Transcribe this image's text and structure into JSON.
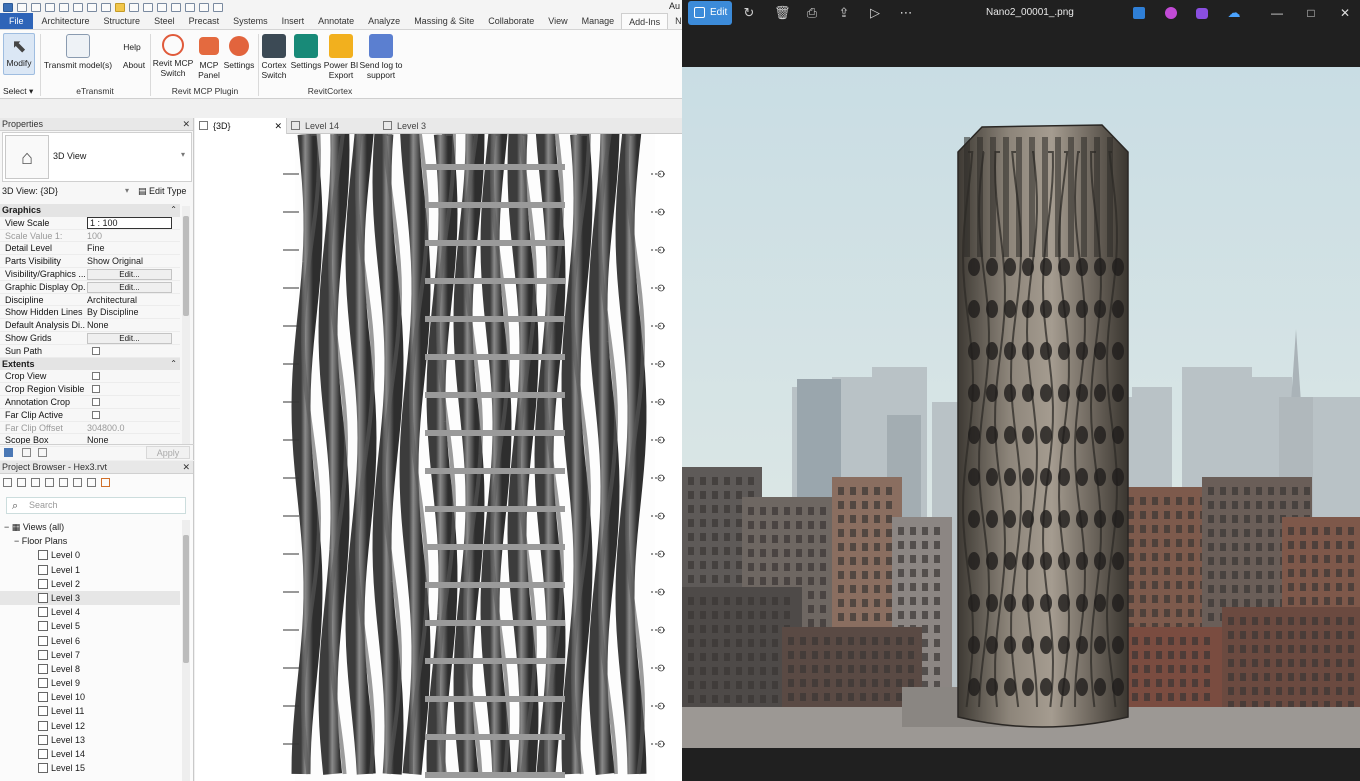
{
  "revit": {
    "title_fragment": "Au",
    "tabs": [
      "File",
      "Architecture",
      "Structure",
      "Steel",
      "Precast",
      "Systems",
      "Insert",
      "Annotate",
      "Analyze",
      "Massing & Site",
      "Collaborate",
      "View",
      "Manage",
      "Add-Ins",
      "NonicaTab"
    ],
    "active_tab": "Add-Ins",
    "ribbon": {
      "modify": "Modify",
      "select": "Select",
      "transmit": "Transmit model(s)",
      "help": "Help",
      "about": "About",
      "mcp_switch": "Revit MCP Switch",
      "mcp_panel": "MCP Panel",
      "mcp_settings": "Settings",
      "cortex_switch": "Cortex Switch",
      "cortex_settings": "Settings",
      "powerbi": "Power BI Export",
      "sendlog": "Send log to support",
      "groups": {
        "etransmit": "eTransmit",
        "mcp": "Revit MCP Plugin",
        "cortex": "RevitCortex"
      }
    },
    "properties": {
      "title": "Properties",
      "type_name": "3D View",
      "selector": "3D View: {3D}",
      "edit_type": "Edit Type",
      "apply": "Apply",
      "graphics_header": "Graphics",
      "extents_header": "Extents",
      "rows_graphics": [
        {
          "k": "View Scale",
          "v": "1 : 100",
          "t": "input"
        },
        {
          "k": "Scale Value    1:",
          "v": "100",
          "t": "dim"
        },
        {
          "k": "Detail Level",
          "v": "Fine",
          "t": "text"
        },
        {
          "k": "Parts Visibility",
          "v": "Show Original",
          "t": "text"
        },
        {
          "k": "Visibility/Graphics ...",
          "v": "Edit...",
          "t": "button"
        },
        {
          "k": "Graphic Display Op...",
          "v": "Edit...",
          "t": "button"
        },
        {
          "k": "Discipline",
          "v": "Architectural",
          "t": "text"
        },
        {
          "k": "Show Hidden Lines",
          "v": "By Discipline",
          "t": "text"
        },
        {
          "k": "Default Analysis Di...",
          "v": "None",
          "t": "text"
        },
        {
          "k": "Show Grids",
          "v": "Edit...",
          "t": "button"
        },
        {
          "k": "Sun Path",
          "v": "",
          "t": "check"
        }
      ],
      "rows_extents": [
        {
          "k": "Crop View",
          "v": "",
          "t": "check"
        },
        {
          "k": "Crop Region Visible",
          "v": "",
          "t": "check"
        },
        {
          "k": "Annotation Crop",
          "v": "",
          "t": "check"
        },
        {
          "k": "Far Clip Active",
          "v": "",
          "t": "check"
        },
        {
          "k": "Far Clip Offset",
          "v": "304800.0",
          "t": "dim"
        },
        {
          "k": "Scope Box",
          "v": "None",
          "t": "text"
        }
      ]
    },
    "browser": {
      "title": "Project Browser - Hex3.rvt",
      "search_placeholder": "Search",
      "views_root": "Views (all)",
      "floor_plans": "Floor Plans",
      "levels": [
        "Level 0",
        "Level 1",
        "Level 2",
        "Level 3",
        "Level 4",
        "Level 5",
        "Level 6",
        "Level 7",
        "Level 8",
        "Level 9",
        "Level 10",
        "Level 11",
        "Level 12",
        "Level 13",
        "Level 14",
        "Level 15"
      ],
      "selected_level": "Level 3"
    },
    "view_tabs": [
      {
        "label": "{3D}",
        "active": true
      },
      {
        "label": "Level 14",
        "active": false
      },
      {
        "label": "Level 3",
        "active": false
      }
    ]
  },
  "photos": {
    "edit": "Edit",
    "filename": "Nano2_00001_.png",
    "icons": [
      "rotate-icon",
      "delete-icon",
      "print-icon",
      "share-icon",
      "slideshow-icon",
      "more-icon"
    ],
    "window_controls": [
      "—",
      "□",
      "✕"
    ]
  }
}
